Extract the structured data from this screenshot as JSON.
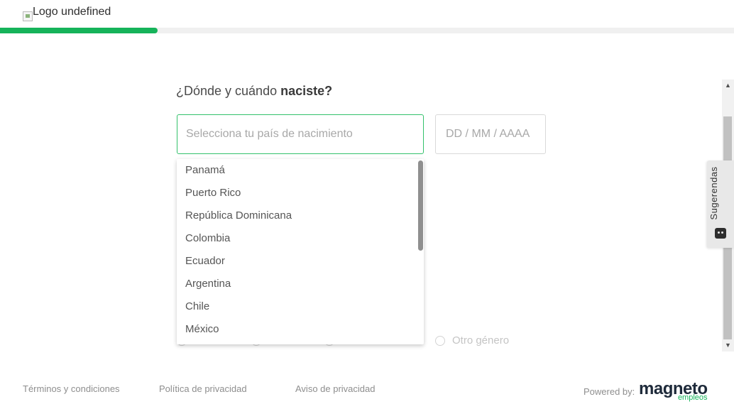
{
  "header": {
    "logo_alt": "Logo undefined",
    "progress_percent": 21.5
  },
  "form": {
    "question_prefix": "¿Dónde y cuándo ",
    "question_bold": "naciste?",
    "country_placeholder": "Selecciona tu país de nacimiento",
    "date_placeholder": "DD / MM / AAAA",
    "country_options": [
      {
        "label": "Panamá"
      },
      {
        "label": "Puerto Rico"
      },
      {
        "label": "República Dominicana"
      },
      {
        "label": "Colombia"
      },
      {
        "label": "Ecuador"
      },
      {
        "label": "Argentina"
      },
      {
        "label": "Chile"
      },
      {
        "label": "México"
      }
    ],
    "gender_last_label": "Otro género"
  },
  "sidebar_tab": {
    "label": "Sugerendas",
    "icon": "smiley-face-icon"
  },
  "footer": {
    "terms": "Términos y condiciones",
    "privacy_policy": "Política de privacidad",
    "privacy_notice": "Aviso de privacidad",
    "powered_by": "Powered by:",
    "brand_name": "magneto",
    "brand_sub": "empleos"
  },
  "colors": {
    "accent": "#16b35a",
    "input_focus_border": "#33c16b",
    "brand_dark": "#1e2a3a"
  }
}
